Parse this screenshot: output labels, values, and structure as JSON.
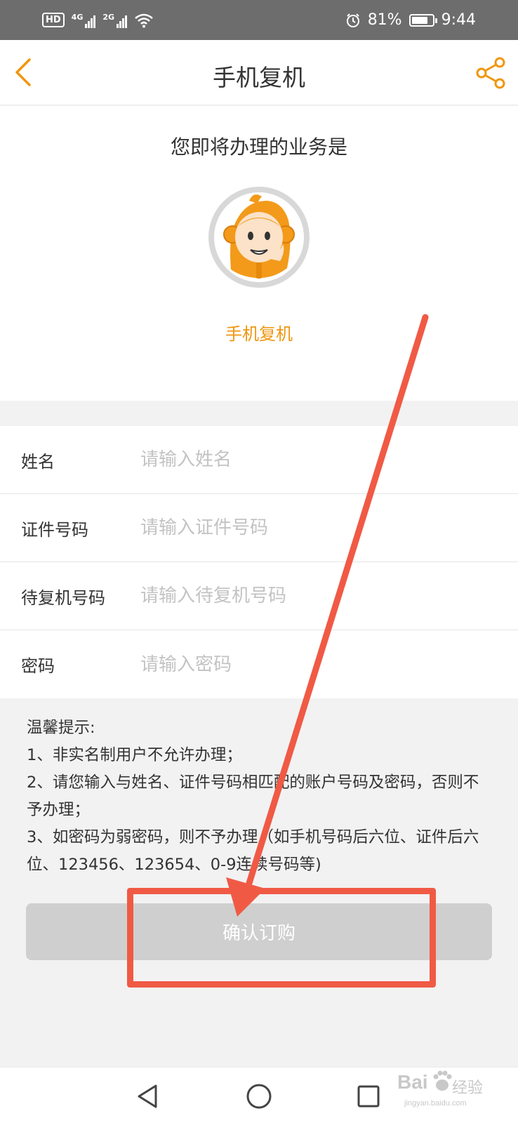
{
  "status_bar": {
    "left_badge": "HD",
    "net1": "4G",
    "net2": "2G",
    "battery_level": "81%",
    "battery_fraction": 0.81,
    "time": "9:44"
  },
  "nav": {
    "title": "手机复机",
    "back_icon": "chevron-left-icon",
    "share_icon": "share-icon"
  },
  "hero": {
    "caption": "您即将办理的业务是",
    "service_name": "手机复机"
  },
  "form": {
    "rows": [
      {
        "label": "姓名",
        "placeholder": "请输入姓名"
      },
      {
        "label": "证件号码",
        "placeholder": "请输入证件号码"
      },
      {
        "label": "待复机号码",
        "placeholder": "请输入待复机号码"
      },
      {
        "label": "密码",
        "placeholder": "请输入密码"
      }
    ]
  },
  "tips": {
    "title": "温馨提示:",
    "items": [
      "1、非实名制用户不允许办理；",
      "2、请您输入与姓名、证件号码相匹配的账户号码及密码，否则不予办理；",
      "3、如密码为弱密码，则不予办理（如手机号码后六位、证件后六位、123456、123654、0-9连续号码等)"
    ]
  },
  "confirm_button": {
    "label": "确认订购"
  },
  "colors": {
    "accent": "#f0960f",
    "status_bar": "#6d6d6d",
    "annotation": "#f05a45",
    "button_disabled": "#cfcfcf"
  },
  "bottom_nav": {
    "icons": [
      "back-triangle-icon",
      "home-circle-icon",
      "recents-square-icon"
    ]
  },
  "watermark": {
    "brand": "Bai",
    "cn": "经验",
    "domain": "jingyan.baidu.com"
  }
}
